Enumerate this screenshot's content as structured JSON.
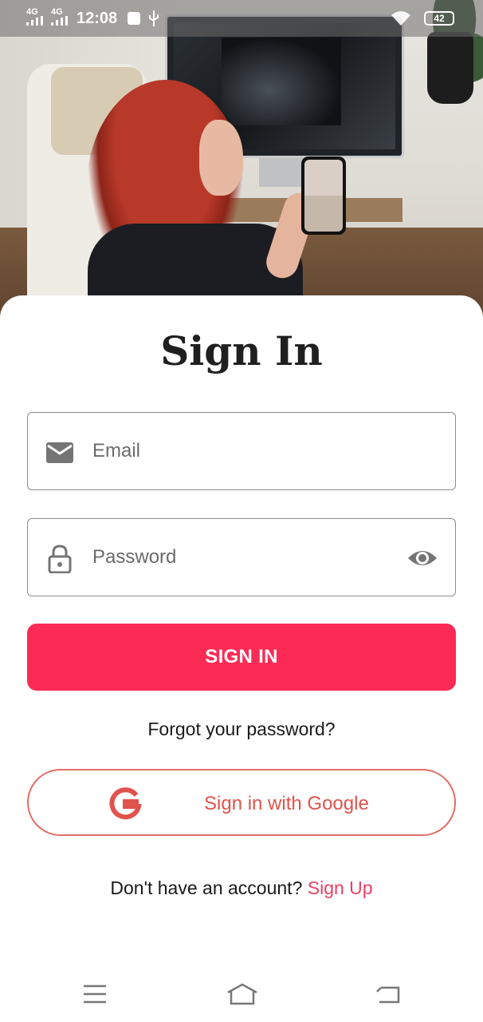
{
  "status_bar": {
    "network_1": "4G",
    "network_2": "4G",
    "time": "12:08",
    "battery": "42"
  },
  "form": {
    "title": "Sign In",
    "email_placeholder": "Email",
    "password_placeholder": "Password",
    "sign_in_button": "SIGN IN",
    "forgot_password": "Forgot your password?",
    "google_button": "Sign in with Google",
    "no_account_text": "Don't have an account?",
    "sign_up_link": "Sign Up"
  },
  "icons": {
    "email": "mail-icon",
    "password": "lock-icon",
    "visibility": "eye-icon",
    "google": "google-icon",
    "menu": "menu-icon",
    "home": "home-icon",
    "back": "back-icon"
  },
  "colors": {
    "primary": "#fc2b55",
    "google_accent": "#e0534d",
    "link": "#ec3f63"
  }
}
